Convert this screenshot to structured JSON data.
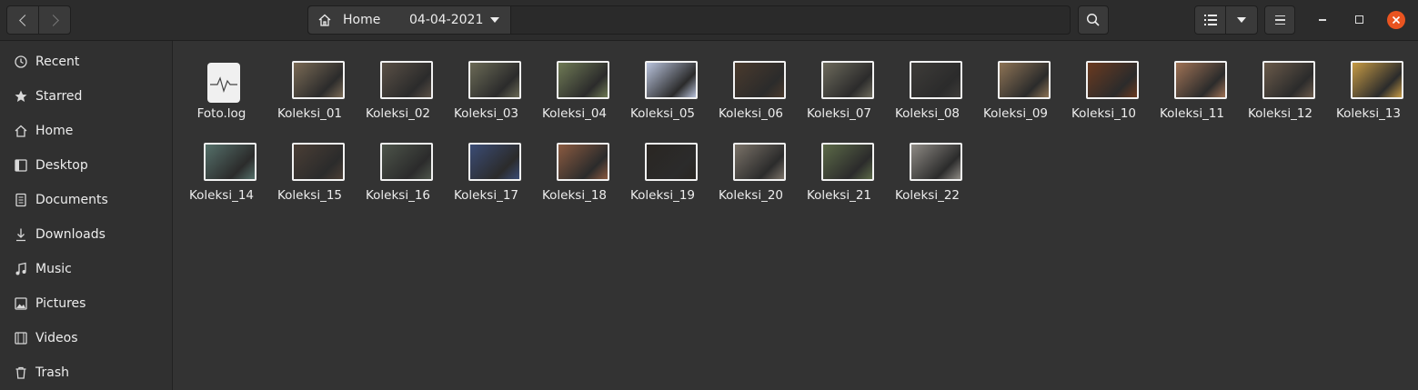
{
  "headerbar": {
    "path": [
      {
        "label": "Home",
        "icon": "home-icon"
      },
      {
        "label": "04-04-2021"
      }
    ]
  },
  "sidebar": {
    "items": [
      {
        "label": "Recent",
        "icon": "clock-icon"
      },
      {
        "label": "Starred",
        "icon": "star-icon"
      },
      {
        "label": "Home",
        "icon": "home-icon"
      },
      {
        "label": "Desktop",
        "icon": "desktop-icon"
      },
      {
        "label": "Documents",
        "icon": "document-icon"
      },
      {
        "label": "Downloads",
        "icon": "download-icon"
      },
      {
        "label": "Music",
        "icon": "music-icon"
      },
      {
        "label": "Pictures",
        "icon": "picture-icon"
      },
      {
        "label": "Videos",
        "icon": "video-icon"
      },
      {
        "label": "Trash",
        "icon": "trash-icon"
      }
    ]
  },
  "files": [
    {
      "name": "Foto.log",
      "type": "log"
    },
    {
      "name": "Koleksi_01",
      "type": "image",
      "color": "#7a6a55"
    },
    {
      "name": "Koleksi_02",
      "type": "image",
      "color": "#5a5046"
    },
    {
      "name": "Koleksi_03",
      "type": "image",
      "color": "#6b6a56"
    },
    {
      "name": "Koleksi_04",
      "type": "image",
      "color": "#6f7a55"
    },
    {
      "name": "Koleksi_05",
      "type": "image",
      "color": "#b9c3dc"
    },
    {
      "name": "Koleksi_06",
      "type": "image",
      "color": "#4a3a2c"
    },
    {
      "name": "Koleksi_07",
      "type": "image",
      "color": "#6d6a5c"
    },
    {
      "name": "Koleksi_08",
      "type": "image",
      "color": "#3e3c39"
    },
    {
      "name": "Koleksi_09",
      "type": "image",
      "color": "#8d7355"
    },
    {
      "name": "Koleksi_10",
      "type": "image",
      "color": "#6b3a20"
    },
    {
      "name": "Koleksi_11",
      "type": "image",
      "color": "#9f7255"
    },
    {
      "name": "Koleksi_12",
      "type": "image",
      "color": "#6a5a4a"
    },
    {
      "name": "Koleksi_13",
      "type": "image",
      "color": "#c79b45"
    },
    {
      "name": "Koleksi_14",
      "type": "image",
      "color": "#55706a"
    },
    {
      "name": "Koleksi_15",
      "type": "image",
      "color": "#4a3e35"
    },
    {
      "name": "Koleksi_16",
      "type": "image",
      "color": "#4d544a"
    },
    {
      "name": "Koleksi_17",
      "type": "image",
      "color": "#3b4c75"
    },
    {
      "name": "Koleksi_18",
      "type": "image",
      "color": "#8a5a40"
    },
    {
      "name": "Koleksi_19",
      "type": "image",
      "color": "#2a2622"
    },
    {
      "name": "Koleksi_20",
      "type": "image",
      "color": "#7a7268"
    },
    {
      "name": "Koleksi_21",
      "type": "image",
      "color": "#5c6a48"
    },
    {
      "name": "Koleksi_22",
      "type": "image",
      "color": "#8e8a84"
    }
  ],
  "colors": {
    "accent_close": "#e95420",
    "background": "#333333",
    "sidebar": "#303030",
    "headerbar": "#2c2c2c"
  }
}
